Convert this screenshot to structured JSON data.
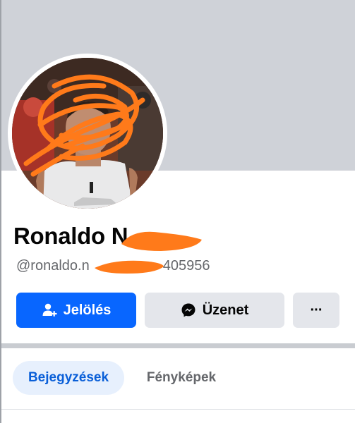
{
  "profile": {
    "name": "Ronaldo N",
    "handle": "@ronaldo.n",
    "handle_suffix": "405956"
  },
  "actions": {
    "add_friend_label": "Jelölés",
    "message_label": "Üzenet",
    "more_label": "···"
  },
  "tabs": [
    {
      "label": "Bejegyzések",
      "active": true
    },
    {
      "label": "Fényképek",
      "active": false
    }
  ],
  "colors": {
    "primary": "#0866ff",
    "secondary_bg": "#e4e6eb",
    "cover": "#cfd2d8",
    "redaction": "#ff7a1a",
    "active_tab_bg": "#e7f0fd",
    "active_tab_text": "#0a5fd8"
  },
  "icons": {
    "add_friend": "person-plus-icon",
    "message": "messenger-icon",
    "more": "ellipsis-icon"
  }
}
